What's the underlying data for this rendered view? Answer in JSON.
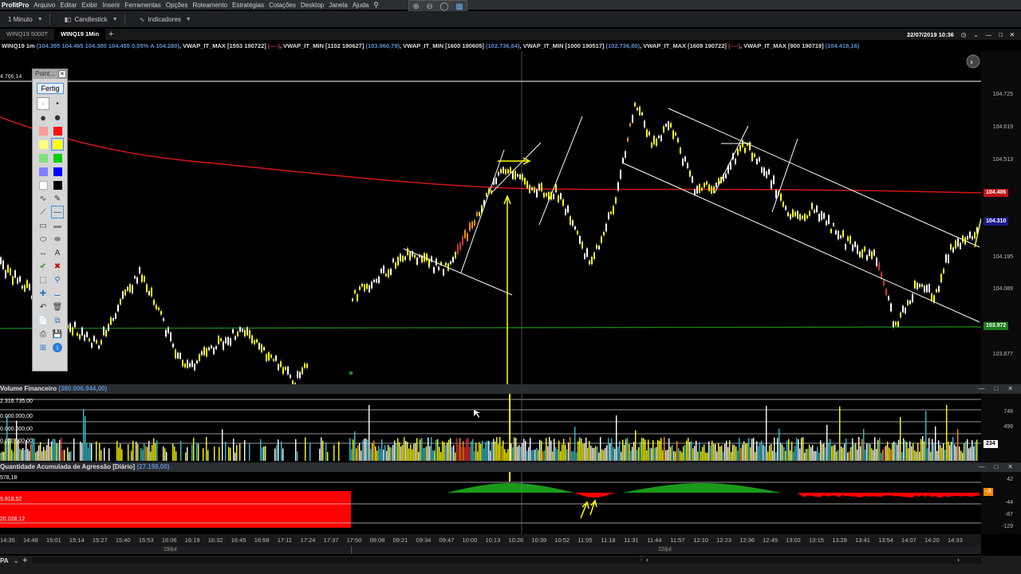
{
  "menubar": {
    "brand": "ProfitPro",
    "items": [
      "Arquivo",
      "Editar",
      "Exibir",
      "Inserir",
      "Ferramentas",
      "Opções",
      "Roteamento",
      "Estratégias",
      "Cotações",
      "Desktop",
      "Janela",
      "Ajuda"
    ]
  },
  "toolbar": {
    "interval": "1 Minuto",
    "chart_type": "Candlestick",
    "indicators": "Indicadores"
  },
  "tabs": {
    "items": [
      "WINQ19 5000T",
      "WINQ19 1Min"
    ],
    "active_index": 1,
    "datetime": "22/07/2019 10:36"
  },
  "infoline": {
    "symbol": "WINQ19 1m",
    "ohlc": "(104.395  104.465  104.380  104.455  0,05%  A 104.280)",
    "vwaps": [
      {
        "name": "VWAP_IT_MAX [1553 190722]",
        "val": "(----)",
        "red": true
      },
      {
        "name": "VWAP_IT_MIN [1102 190627]",
        "val": "(103.960,79)",
        "red": false
      },
      {
        "name": "VWAP_IT_MIN [1600 190605]",
        "val": "(102.736,84)",
        "red": false
      },
      {
        "name": "VWAP_IT_MIN [1000 190517]",
        "val": "(102.736,80)",
        "red": false
      },
      {
        "name": "VWAP_IT_MAX [1608 190722]",
        "val": "(----)",
        "red": true
      },
      {
        "name": "VWAP_IT_MAX [900 190719]",
        "val": "(104.418,16)",
        "red": false
      }
    ]
  },
  "main_chart": {
    "top_left_label": "4.766,14",
    "price_labels": [
      "104.725",
      "104.619",
      "104.513",
      "104.195",
      "104.089",
      "103.877"
    ],
    "badges": {
      "red": "104.406",
      "current": "104.310",
      "green": "103.972"
    }
  },
  "volume_pane": {
    "title": "Volume Financeiro",
    "value": "(380.006.944,00)",
    "left_labels": [
      "2.316.735,00",
      "0.000.000,00",
      "0.000.000,00",
      "0.000.000,00"
    ],
    "right_labels": [
      "748",
      "499",
      "234"
    ]
  },
  "agressao_pane": {
    "title": "Quantidade Acumulada de Agressão [Diário]",
    "value": "(27.198,00)",
    "left_labels": [
      "578,18",
      "5.918,52",
      "20.028,12"
    ],
    "right_labels": [
      "42",
      "-3",
      "-44",
      "-87",
      "-129"
    ]
  },
  "time_axis": [
    "14:35",
    "14:48",
    "15:01",
    "15:14",
    "15:27",
    "15:40",
    "15:53",
    "16:06",
    "16:19",
    "16:32",
    "16:45",
    "16:58",
    "17:11",
    "17:24",
    "17:37",
    "17:50",
    "09:08",
    "09:21",
    "09:34",
    "09:47",
    "10:00",
    "10:13",
    "10:26",
    "10:39",
    "10:52",
    "11:05",
    "11:18",
    "11:31",
    "11:44",
    "11:57",
    "12:10",
    "12:23",
    "12:36",
    "12:49",
    "13:02",
    "13:15",
    "13:28",
    "13:41",
    "13:54",
    "14:07",
    "14:20",
    "14:33"
  ],
  "date_axis": [
    "19/jul",
    "22/jul"
  ],
  "toolpanel": {
    "title": "Point...",
    "fertig": "Fertig",
    "colors": [
      "#ff9a9a",
      "#ff1010",
      "#ffff80",
      "#ffff00",
      "#80e080",
      "#00d000",
      "#8080ff",
      "#0000ff",
      "#ffffff",
      "#000000"
    ]
  },
  "bottombar": {
    "tab": "PA"
  }
}
